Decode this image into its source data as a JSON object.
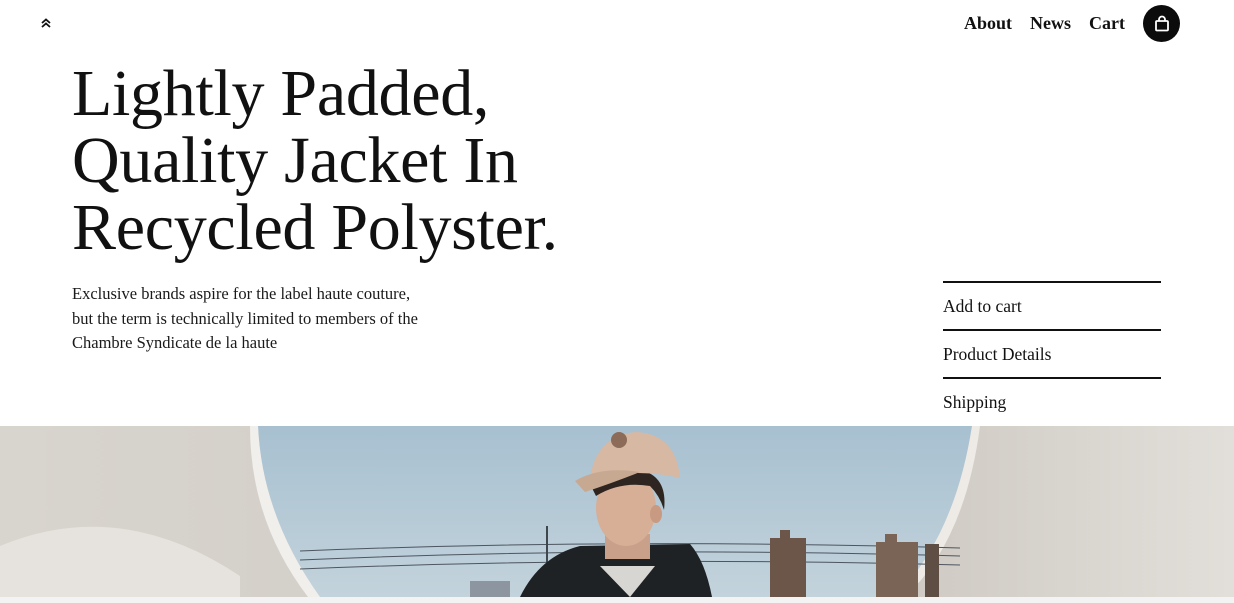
{
  "header": {
    "logo_icon": "chevrons-up-icon",
    "nav": [
      {
        "label": "About"
      },
      {
        "label": "News"
      },
      {
        "label": "Cart"
      }
    ],
    "cart_icon": "shopping-bag-icon"
  },
  "hero": {
    "title_lines": [
      "Lightly Padded,",
      "Quality Jacket In",
      "Recycled Polyster."
    ],
    "description": "Exclusive brands aspire for the label haute couture, but the term is technically limited to members of the Chambre Syndicate de la haute"
  },
  "accordion": {
    "items": [
      {
        "label": "Add to cart"
      },
      {
        "label": "Product Details"
      },
      {
        "label": "Shipping"
      }
    ]
  },
  "colors": {
    "accent": "#0b0b0b",
    "sky": "#a9c3d3",
    "wall": "#dcd9d3"
  }
}
